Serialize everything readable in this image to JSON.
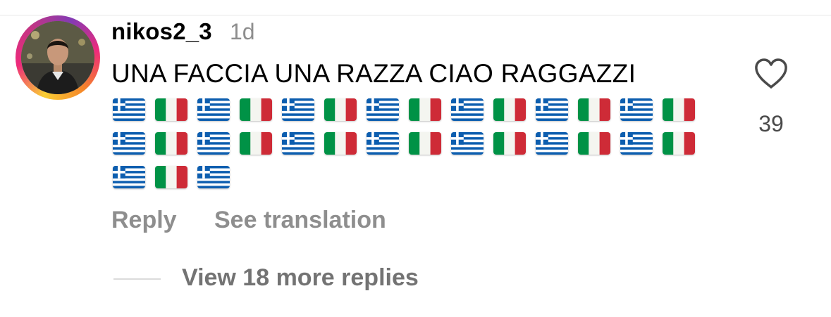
{
  "comment": {
    "username": "nikos2_3",
    "timestamp": "1d",
    "text": "UNA FACCIA UNA RAZZA CIAO RAGGAZZI",
    "flag_rows": [
      [
        "greece-flag",
        "italy-flag",
        "greece-flag",
        "italy-flag",
        "greece-flag",
        "italy-flag",
        "greece-flag",
        "italy-flag",
        "greece-flag",
        "italy-flag",
        "greece-flag",
        "italy-flag",
        "greece-flag",
        "italy-flag"
      ],
      [
        "greece-flag",
        "italy-flag",
        "greece-flag",
        "italy-flag",
        "greece-flag",
        "italy-flag",
        "greece-flag",
        "italy-flag",
        "greece-flag",
        "italy-flag",
        "greece-flag",
        "italy-flag",
        "greece-flag",
        "italy-flag"
      ],
      [
        "greece-flag",
        "italy-flag",
        "greece-flag"
      ]
    ],
    "like_count": "39",
    "like_icon": "heart-icon",
    "reply_label": "Reply",
    "translate_label": "See translation",
    "view_replies_label": "View 18 more replies"
  },
  "colors": {
    "secondary_text": "#8e8e8e",
    "greece_blue": "#0d5eaf",
    "italy_green": "#009246",
    "italy_red": "#ce2b37"
  }
}
